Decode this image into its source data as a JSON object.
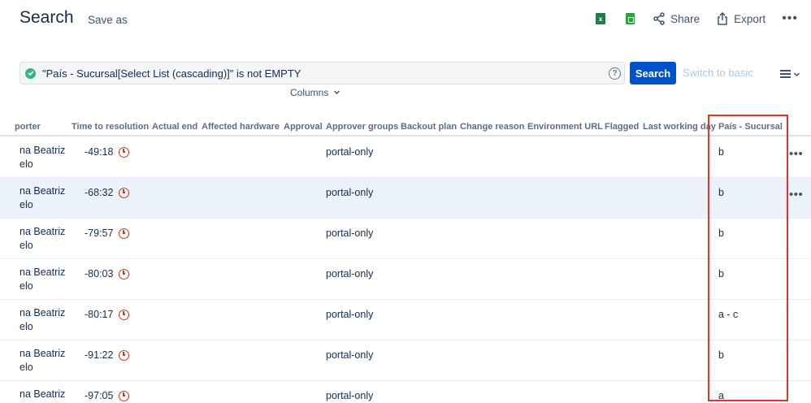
{
  "header": {
    "title": "Search",
    "save_as": "Save as"
  },
  "top_actions": {
    "share": "Share",
    "export": "Export",
    "more": "•••"
  },
  "jql": {
    "query": "\"País - Sucursal[Select List (cascading)]\" is not EMPTY",
    "help": "?"
  },
  "search_button": "Search",
  "switch_basic": "Switch to basic",
  "columns_label": "Columns",
  "table": {
    "headers": [
      "porter",
      "Time to resolution",
      "Actual end",
      "Affected hardware",
      "Approval",
      "Approver groups",
      "Backout plan",
      "Change reason",
      "Environment URL",
      "Flagged",
      "Last working day",
      "País - Sucursal"
    ],
    "rows": [
      {
        "reporter_1": "na Beatriz",
        "reporter_2": "elo",
        "ttr": "-49:18",
        "approver_groups": "portal-only",
        "pais": "b",
        "more": "•••"
      },
      {
        "reporter_1": "na Beatriz",
        "reporter_2": "elo",
        "ttr": "-68:32",
        "approver_groups": "portal-only",
        "pais": "b",
        "more": "•••"
      },
      {
        "reporter_1": "na Beatriz",
        "reporter_2": "elo",
        "ttr": "-79:57",
        "approver_groups": "portal-only",
        "pais": "b"
      },
      {
        "reporter_1": "na Beatriz",
        "reporter_2": "elo",
        "ttr": "-80:03",
        "approver_groups": "portal-only",
        "pais": "b"
      },
      {
        "reporter_1": "na Beatriz",
        "reporter_2": "elo",
        "ttr": "-80:17",
        "approver_groups": "portal-only",
        "pais": "a - c"
      },
      {
        "reporter_1": "na Beatriz",
        "reporter_2": "elo",
        "ttr": "-91:22",
        "approver_groups": "portal-only",
        "pais": "b"
      },
      {
        "reporter_1": "na Beatriz",
        "reporter_2": "elo",
        "ttr": "-97:05",
        "approver_groups": "portal-only",
        "pais": "a"
      }
    ]
  },
  "colors": {
    "accent": "#0052cc",
    "highlight_box": "#e5322d",
    "row_highlight": "#ebf2fa",
    "clock": "#de350b"
  }
}
